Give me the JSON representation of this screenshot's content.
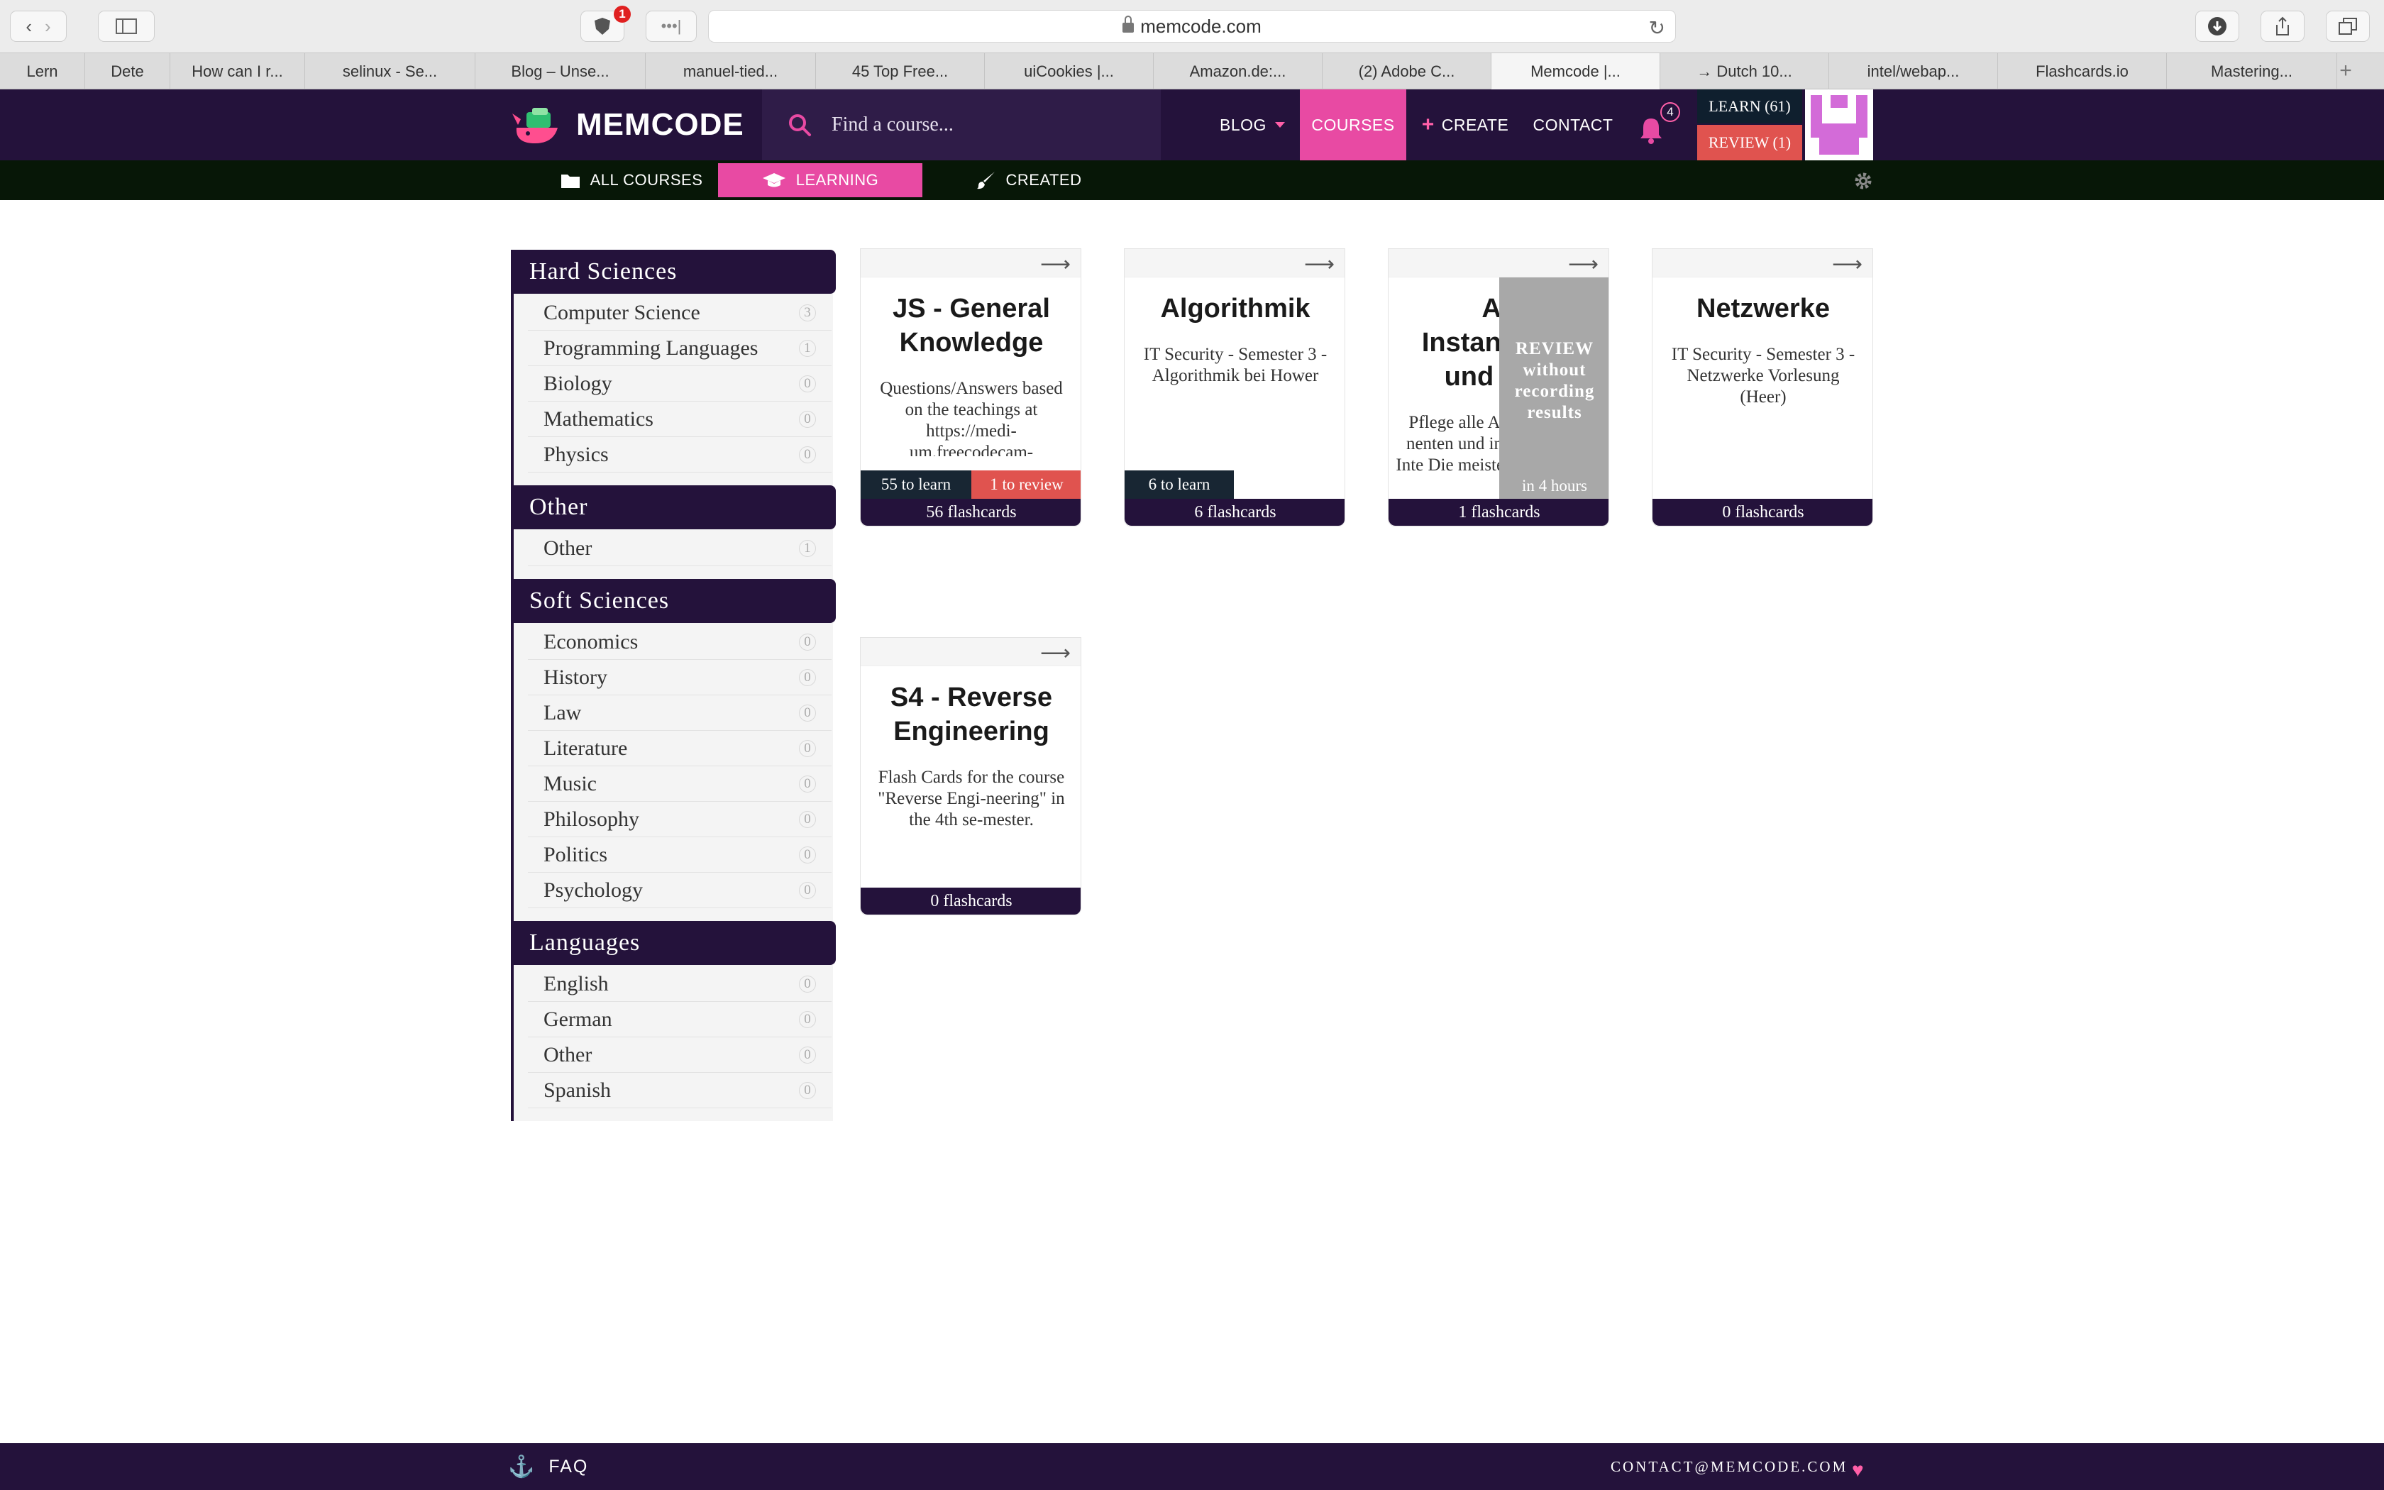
{
  "browser": {
    "url": "memcode.com",
    "ext_badge": "1",
    "tabs": [
      {
        "label": "Lern"
      },
      {
        "label": "Dete"
      },
      {
        "label": "How can I r..."
      },
      {
        "label": "selinux - Se..."
      },
      {
        "label": "Blog – Unse..."
      },
      {
        "label": "manuel-tied..."
      },
      {
        "label": "45 Top Free..."
      },
      {
        "label": "uiCookies |..."
      },
      {
        "label": "Amazon.de:..."
      },
      {
        "label": "(2) Adobe C..."
      },
      {
        "label": "Memcode |...",
        "active": true
      },
      {
        "label": "→ Dutch 10..."
      },
      {
        "label": "intel/webap..."
      },
      {
        "label": "Flashcards.io"
      },
      {
        "label": "Mastering..."
      }
    ]
  },
  "header": {
    "logo_text": "MEMCODE",
    "search_placeholder": "Find a course...",
    "nav": {
      "blog": "BLOG",
      "courses": "COURSES",
      "create": "CREATE",
      "contact": "CONTACT"
    },
    "notifications_count": "4",
    "learn_label": "LEARN (61)",
    "review_label": "REVIEW (1)"
  },
  "subnav": {
    "all_courses": "ALL COURSES",
    "learning": "LEARNING",
    "created": "CREATED"
  },
  "sidebar": {
    "groups": [
      {
        "title": "Hard Sciences",
        "items": [
          {
            "label": "Computer Science",
            "count": "3"
          },
          {
            "label": "Programming Languages",
            "count": "1"
          },
          {
            "label": "Biology",
            "count": "0"
          },
          {
            "label": "Mathematics",
            "count": "0"
          },
          {
            "label": "Physics",
            "count": "0"
          }
        ]
      },
      {
        "title": "Other",
        "items": [
          {
            "label": "Other",
            "count": "1"
          }
        ]
      },
      {
        "title": "Soft Sciences",
        "items": [
          {
            "label": "Economics",
            "count": "0"
          },
          {
            "label": "History",
            "count": "0"
          },
          {
            "label": "Law",
            "count": "0"
          },
          {
            "label": "Literature",
            "count": "0"
          },
          {
            "label": "Music",
            "count": "0"
          },
          {
            "label": "Philosophy",
            "count": "0"
          },
          {
            "label": "Politics",
            "count": "0"
          },
          {
            "label": "Psychology",
            "count": "0"
          }
        ]
      },
      {
        "title": "Languages",
        "items": [
          {
            "label": "English",
            "count": "0"
          },
          {
            "label": "German",
            "count": "0"
          },
          {
            "label": "Other",
            "count": "0"
          },
          {
            "label": "Spanish",
            "count": "0"
          }
        ]
      }
    ]
  },
  "courses": [
    {
      "title": "JS - General Knowledge",
      "description": "Questions/Answers based on the teachings at https://medi-um.freecodecam-",
      "to_learn": "55 to learn",
      "to_review": "1 to review",
      "flashcards": "56 flashcards"
    },
    {
      "title": "Algorithmik",
      "description": "IT Security - Semester 3 - Algorithmik bei Hower",
      "to_learn": "6 to learn",
      "flashcards": "6 flashcards"
    },
    {
      "title": "Au Instand und F",
      "description": "Pflege alle A nenten und in Inte Die meisten",
      "overlay_text": "REVIEW without recording results",
      "overlay_time": "in 4 hours",
      "flashcards": "1 flashcards"
    },
    {
      "title": "Netzwerke",
      "description": "IT Security - Semester 3 - Netzwerke Vorlesung (Heer)",
      "flashcards": "0 flashcards"
    },
    {
      "title": "S4 - Reverse Engineering",
      "description": "Flash Cards for the course \"Reverse Engi-neering\" in the 4th se-mester.",
      "flashcards": "0 flashcards"
    }
  ],
  "footer": {
    "faq": "FAQ",
    "email": "CONTACT@MEMCODE.COM"
  },
  "colors": {
    "brand_dark": "#24123b",
    "accent_pink": "#e84aa3",
    "review_red": "#e0534f"
  }
}
